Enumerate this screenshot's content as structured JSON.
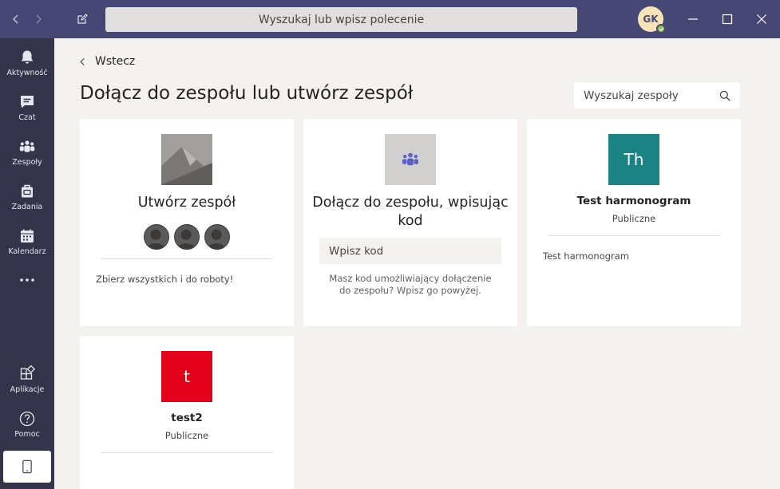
{
  "titlebar": {
    "search_placeholder": "Wyszukaj lub wpisz polecenie",
    "avatar_initials": "GK",
    "colors": {
      "bar": "#464775",
      "presence": "#92c353"
    }
  },
  "rail": {
    "items": [
      {
        "label": "Aktywność",
        "icon": "bell-icon"
      },
      {
        "label": "Czat",
        "icon": "chat-icon"
      },
      {
        "label": "Zespoły",
        "icon": "teams-icon"
      },
      {
        "label": "Zadania",
        "icon": "tasks-icon"
      },
      {
        "label": "Kalendarz",
        "icon": "calendar-icon"
      }
    ],
    "more_icon": "more-icon",
    "bottom": [
      {
        "label": "Aplikacje",
        "icon": "apps-icon"
      },
      {
        "label": "Pomoc",
        "icon": "help-icon"
      }
    ]
  },
  "main": {
    "back_label": "Wstecz",
    "title": "Dołącz do zespołu lub utwórz zespół",
    "search_placeholder": "Wyszukaj zespoły",
    "create_card": {
      "title": "Utwórz zespół",
      "description": "Zbierz wszystkich i do roboty!"
    },
    "join_card": {
      "title_line1": "Dołącz do zespołu, wpisując",
      "title_line2": "kod",
      "code_placeholder": "Wpisz kod",
      "description": "Masz kod umożliwiający dołączenie do zespołu? Wpisz go powyżej."
    },
    "teams": [
      {
        "initials": "Th",
        "name": "Test harmonogram",
        "visibility": "Publiczne",
        "description": "Test harmonogram",
        "color": "#1b8383"
      },
      {
        "initials": "t",
        "name": "test2",
        "visibility": "Publiczne",
        "description": "",
        "color": "#e2001a"
      }
    ]
  }
}
